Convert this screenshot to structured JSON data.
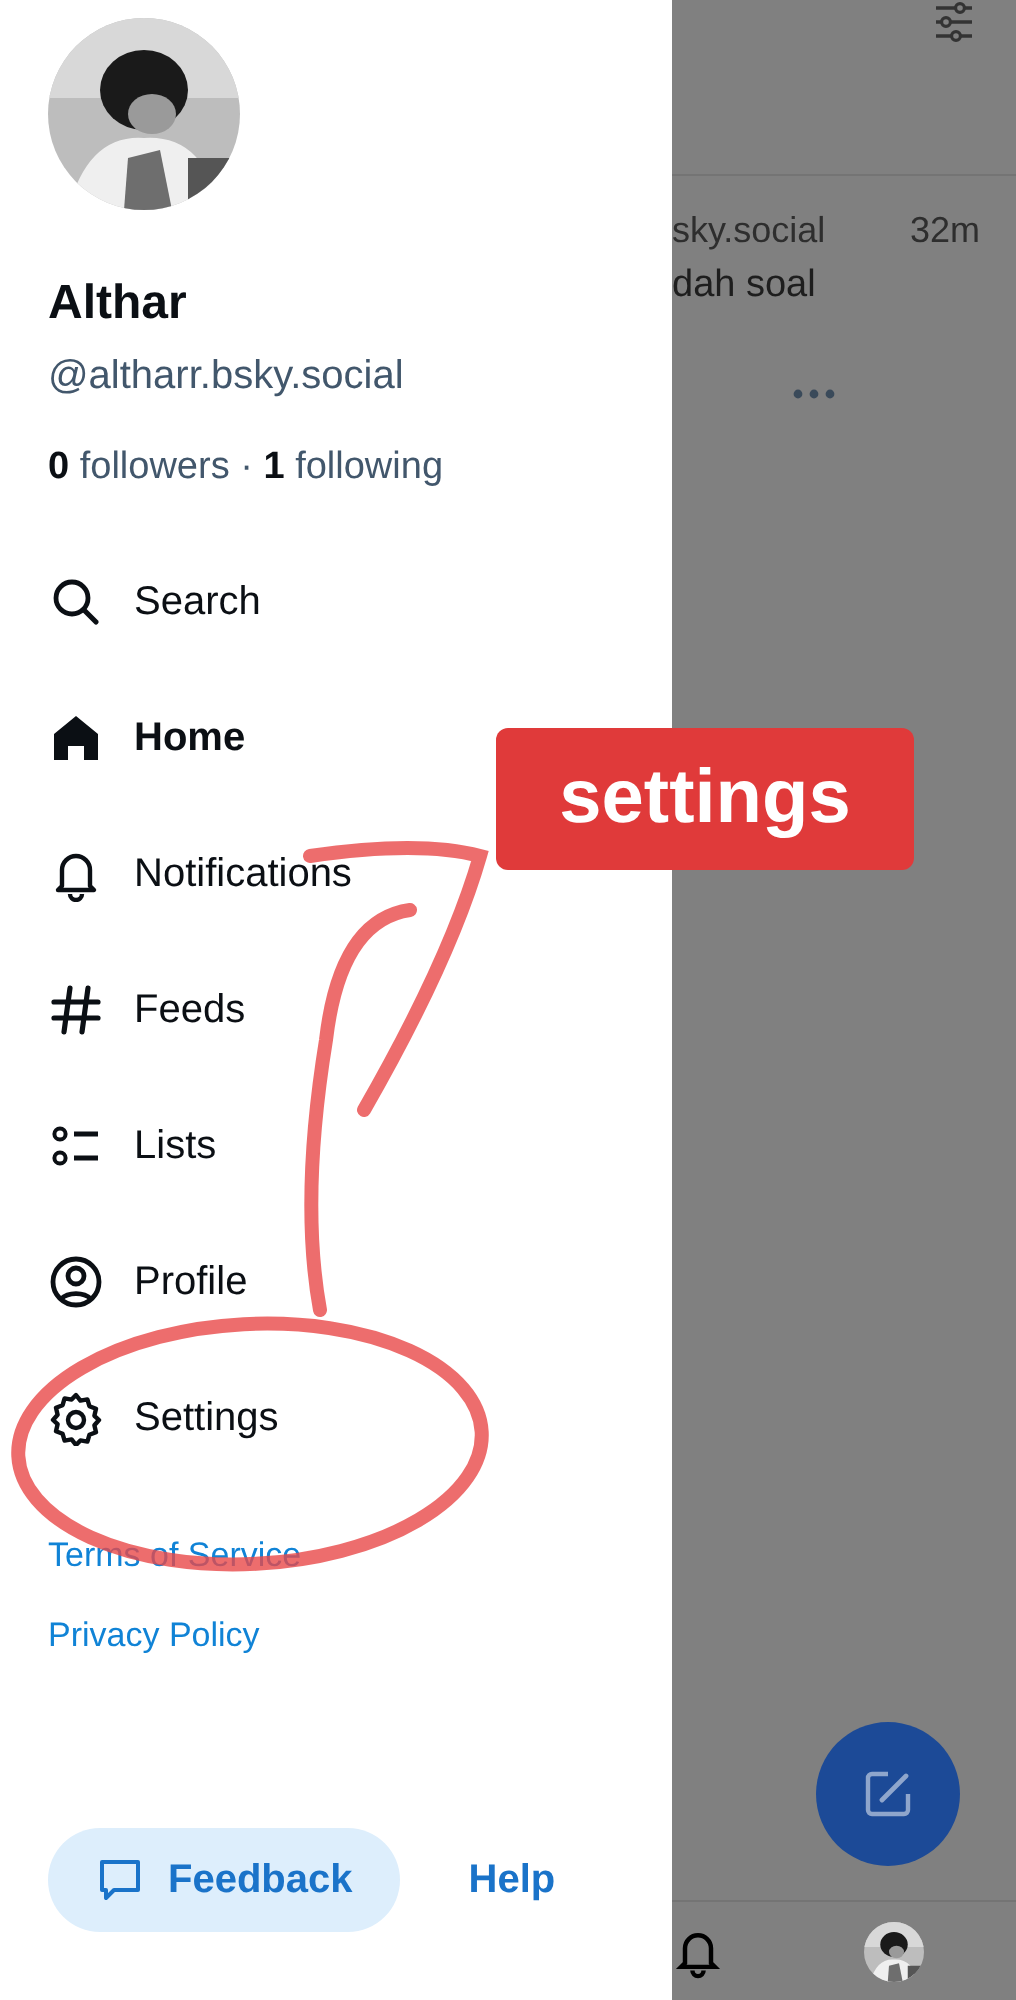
{
  "drawer": {
    "profile": {
      "name": "Althar",
      "handle": "@altharr.bsky.social",
      "stats": "**0** followers · **1** following"
    },
    "menu": [
      {
        "label": "Search",
        "kind": "search",
        "selected": false
      },
      {
        "label": "Home",
        "kind": "home",
        "selected": true
      },
      {
        "label": "Notifications",
        "kind": "notifications",
        "selected": false
      },
      {
        "label": "Feeds",
        "kind": "feeds",
        "selected": false
      },
      {
        "label": "Lists",
        "kind": "lists",
        "selected": false
      },
      {
        "label": "Profile",
        "kind": "profile",
        "selected": false
      },
      {
        "label": "Settings",
        "kind": "settings",
        "selected": false
      }
    ],
    "links": [
      "Terms of Service",
      "Privacy Policy"
    ],
    "feedback_button": "Feedback",
    "help_link": "Help"
  },
  "background_feed": {
    "post": {
      "handle": "sky.social",
      "time": "32m",
      "text": "dah soal"
    }
  },
  "annotation": {
    "label": "settings"
  }
}
